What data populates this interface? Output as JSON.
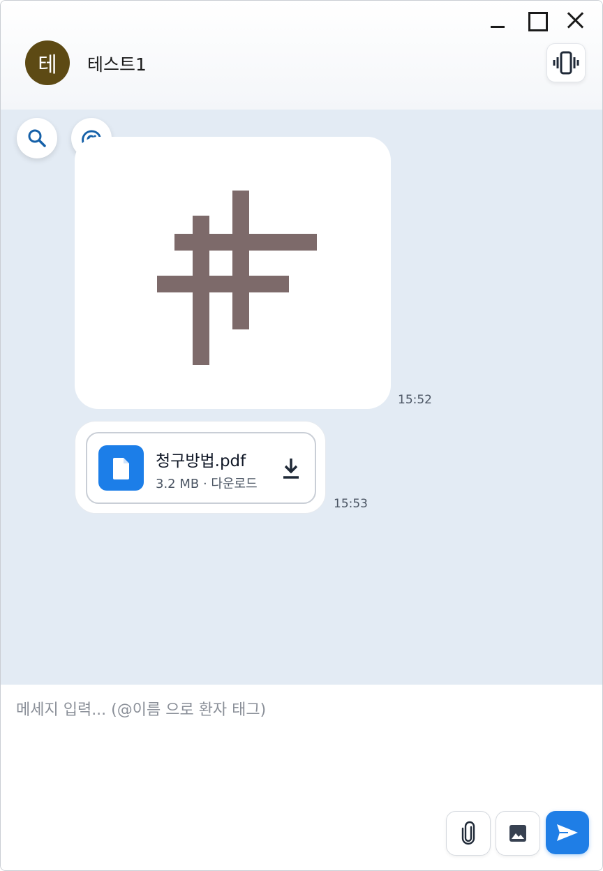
{
  "window": {
    "controls": [
      "minimize",
      "maximize",
      "close"
    ]
  },
  "header": {
    "avatar_initial": "테",
    "title": "테스트1",
    "avatar_color": "#5d4a14",
    "vibrate_icon": "vibrate-icon"
  },
  "tools": {
    "search_icon": "search-icon",
    "mention_label": "@"
  },
  "messages": [
    {
      "type": "image",
      "time": "15:52",
      "image_icon": "hash-sign-image"
    },
    {
      "type": "file",
      "time": "15:53",
      "file_name": "청구방법.pdf",
      "file_meta": "3.2 MB · 다운로드",
      "file_icon": "document-icon",
      "download_icon": "download-icon"
    }
  ],
  "composer": {
    "placeholder": "메세지 입력... (@이름 으로 환자 태그)",
    "value": "",
    "attach_icon": "paperclip-icon",
    "image_icon": "image-icon",
    "send_icon": "send-icon"
  },
  "colors": {
    "accent": "#1f7ee6",
    "chat_bg": "#e3ebf4"
  }
}
